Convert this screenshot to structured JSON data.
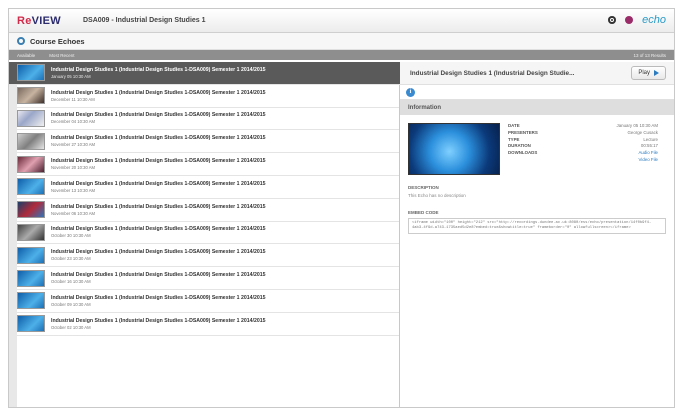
{
  "app": {
    "logo_prefix": "Re",
    "logo_rest": "VIEW",
    "course_title": "DSA009 - Industrial Design Studies 1",
    "echo_brand": "echo"
  },
  "section": {
    "title": "Course Echoes"
  },
  "filters": {
    "available": "Available",
    "most_recent": "Most Recent",
    "count": "13 of 13 Results"
  },
  "list": {
    "items": [
      {
        "title": "Industrial Design Studies 1 (Industrial Design Studies 1-DSA009) Semester 1 2014/2015",
        "date": "January 05 10:30 AM",
        "thumb": "v1"
      },
      {
        "title": "Industrial Design Studies 1 (Industrial Design Studies 1-DSA009) Semester 1 2014/2015",
        "date": "December 11 10:30 AM",
        "thumb": "v2"
      },
      {
        "title": "Industrial Design Studies 1 (Industrial Design Studies 1-DSA009) Semester 1 2014/2015",
        "date": "December 04 10:30 AM",
        "thumb": "v3"
      },
      {
        "title": "Industrial Design Studies 1 (Industrial Design Studies 1-DSA009) Semester 1 2014/2015",
        "date": "November 27 10:30 AM",
        "thumb": "v4"
      },
      {
        "title": "Industrial Design Studies 1 (Industrial Design Studies 1-DSA009) Semester 1 2014/2015",
        "date": "November 20 10:30 AM",
        "thumb": "v5"
      },
      {
        "title": "Industrial Design Studies 1 (Industrial Design Studies 1-DSA009) Semester 1 2014/2015",
        "date": "November 13 10:30 AM",
        "thumb": "v1"
      },
      {
        "title": "Industrial Design Studies 1 (Industrial Design Studies 1-DSA009) Semester 1 2014/2015",
        "date": "November 06 10:30 AM",
        "thumb": "v6"
      },
      {
        "title": "Industrial Design Studies 1 (Industrial Design Studies 1-DSA009) Semester 1 2014/2015",
        "date": "October 30 10:30 AM",
        "thumb": "v7"
      },
      {
        "title": "Industrial Design Studies 1 (Industrial Design Studies 1-DSA009) Semester 1 2014/2015",
        "date": "October 23 10:30 AM",
        "thumb": "v1"
      },
      {
        "title": "Industrial Design Studies 1 (Industrial Design Studies 1-DSA009) Semester 1 2014/2015",
        "date": "October 16 10:30 AM",
        "thumb": "v1"
      },
      {
        "title": "Industrial Design Studies 1 (Industrial Design Studies 1-DSA009) Semester 1 2014/2015",
        "date": "October 09 10:30 AM",
        "thumb": "v1"
      },
      {
        "title": "Industrial Design Studies 1 (Industrial Design Studies 1-DSA009) Semester 1 2014/2015",
        "date": "October 02 10:30 AM",
        "thumb": "v1"
      }
    ]
  },
  "detail": {
    "title": "Industrial Design Studies 1 (Industrial Design Studie...",
    "play_label": "Play",
    "info_label": "Information",
    "meta": {
      "date_key": "DATE",
      "date_val": "January 05 10:30 AM",
      "presenter_key": "PRESENTERS",
      "presenter_val": "George Cusack",
      "type_key": "TYPE",
      "type_val": "Lecture",
      "duration_key": "DURATION",
      "duration_val": "00:55:17",
      "downloads_key": "DOWNLOADS",
      "download_audio": "Audio File",
      "download_video": "Video File"
    },
    "description_label": "DESCRIPTION",
    "description_text": "This Echo has no description",
    "embed_label": "EMBED CODE",
    "embed_code": "<iframe width=\"100\" height=\"212\" src=\"http://recordings.dundee.ac.uk:8080/ess/echo/presentation/14f0b9f4-4ab3-4f9d-a743-1735aed5d2e8?embed=true&showtitle=true\" frameborder=\"0\" allowfullscreen></iframe>"
  },
  "colors": {
    "selected_row": "#5a5a5a",
    "accent": "#2a7bc0",
    "logo_red": "#d12a4a"
  }
}
